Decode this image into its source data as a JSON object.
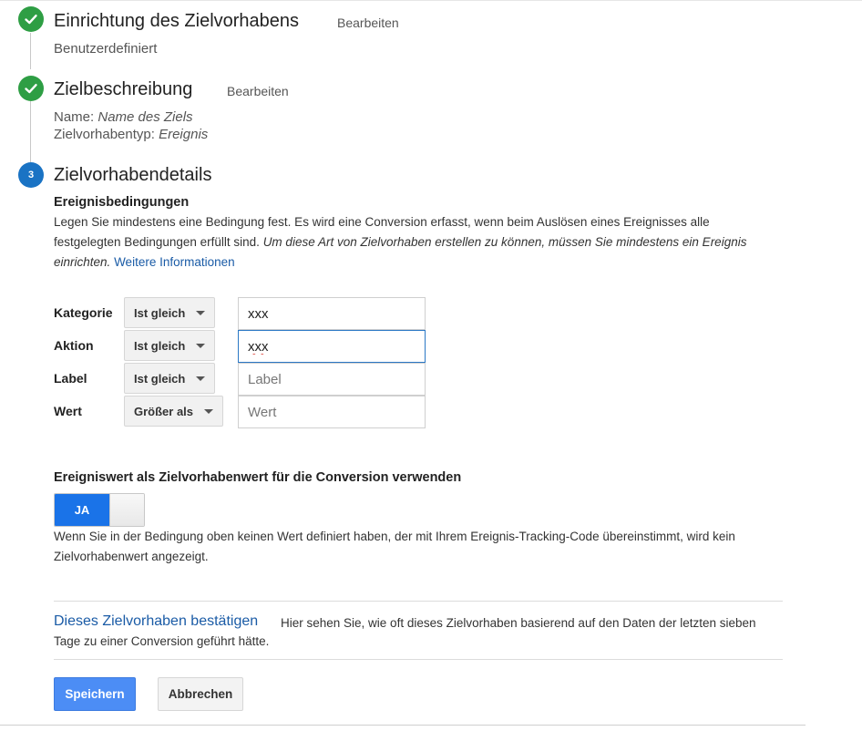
{
  "steps": [
    {
      "title": "Einrichtung des Zielvorhabens",
      "edit_label": "Bearbeiten",
      "summary": "Benutzerdefiniert"
    },
    {
      "title": "Zielbeschreibung",
      "edit_label": "Bearbeiten",
      "name_label": "Name:",
      "name_value": "Name des Ziels",
      "type_label": "Zielvorhabentyp:",
      "type_value": "Ereignis"
    },
    {
      "number": "3",
      "title": "Zielvorhabendetails"
    }
  ],
  "event_conditions": {
    "heading": "Ereignisbedingungen",
    "description": "Legen Sie mindestens eine Bedingung fest. Es wird eine Conversion erfasst, wenn beim Auslösen eines Ereignisses alle festgelegten Bedingungen erfüllt sind.",
    "description_italic": "Um diese Art von Zielvorhaben erstellen zu können, müssen Sie mindestens ein Ereignis einrichten.",
    "more_info_link": "Weitere Informationen",
    "rows": [
      {
        "label": "Kategorie",
        "operator": "Ist gleich",
        "value": "xxx",
        "placeholder": ""
      },
      {
        "label": "Aktion",
        "operator": "Ist gleich",
        "value": "xxx",
        "placeholder": ""
      },
      {
        "label": "Label",
        "operator": "Ist gleich",
        "value": "",
        "placeholder": "Label"
      },
      {
        "label": "Wert",
        "operator": "Größer als",
        "value": "",
        "placeholder": "Wert"
      }
    ]
  },
  "use_event_value": {
    "heading": "Ereigniswert als Zielvorhabenwert für die Conversion verwenden",
    "toggle_label": "JA",
    "toggle_on": true,
    "note": "Wenn Sie in der Bedingung oben keinen Wert definiert haben, der mit Ihrem Ereignis-Tracking-Code übereinstimmt, wird kein Zielvorhabenwert angezeigt."
  },
  "verify": {
    "link": "Dieses Zielvorhaben bestätigen",
    "text": "Hier sehen Sie, wie oft dieses Zielvorhaben basierend auf den Daten der letzten sieben Tage zu einer Conversion geführt hätte."
  },
  "actions": {
    "save_label": "Speichern",
    "cancel_label": "Abbrechen"
  },
  "colors": {
    "done": "#2e9e44",
    "current": "#1a73c4",
    "link": "#1a5ba6",
    "primary": "#4c8df5",
    "toggle_on": "#1a73e8"
  }
}
